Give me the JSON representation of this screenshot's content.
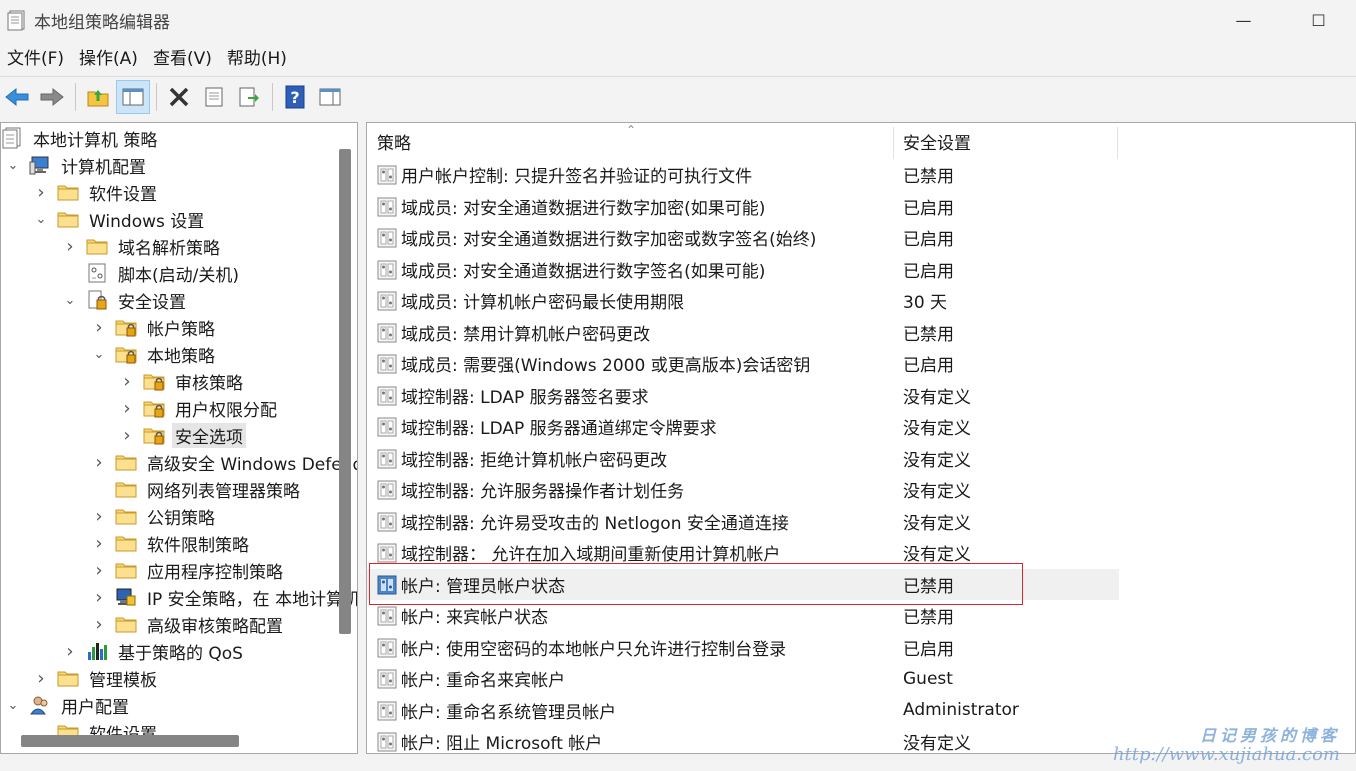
{
  "window": {
    "title": "本地组策略编辑器",
    "minimize": "—",
    "maximize": "☐"
  },
  "menu": [
    "文件(F)",
    "操作(A)",
    "查看(V)",
    "帮助(H)"
  ],
  "tree": [
    {
      "label": "本地计算机 策略",
      "icon": "policy-icon"
    },
    {
      "label": "计算机配置",
      "icon": "computer-icon"
    },
    {
      "label": "软件设置",
      "icon": "folder-icon"
    },
    {
      "label": "Windows 设置",
      "icon": "folder-icon"
    },
    {
      "label": "域名解析策略",
      "icon": "folder-icon"
    },
    {
      "label": "脚本(启动/关机)",
      "icon": "script-icon"
    },
    {
      "label": "安全设置",
      "icon": "security-icon"
    },
    {
      "label": "帐户策略",
      "icon": "lock-folder-icon"
    },
    {
      "label": "本地策略",
      "icon": "lock-folder-icon"
    },
    {
      "label": "审核策略",
      "icon": "lock-folder-icon"
    },
    {
      "label": "用户权限分配",
      "icon": "lock-folder-icon"
    },
    {
      "label": "安全选项",
      "icon": "lock-folder-icon"
    },
    {
      "label": "高级安全 Windows Defender 防火墙",
      "icon": "folder-icon"
    },
    {
      "label": "网络列表管理器策略",
      "icon": "folder-icon"
    },
    {
      "label": "公钥策略",
      "icon": "folder-icon"
    },
    {
      "label": "软件限制策略",
      "icon": "folder-icon"
    },
    {
      "label": "应用程序控制策略",
      "icon": "folder-icon"
    },
    {
      "label": "IP 安全策略，在 本地计算机",
      "icon": "ipsec-icon"
    },
    {
      "label": "高级审核策略配置",
      "icon": "folder-icon"
    },
    {
      "label": "基于策略的 QoS",
      "icon": "chart-icon"
    },
    {
      "label": "管理模板",
      "icon": "folder-icon"
    },
    {
      "label": "用户配置",
      "icon": "user-icon"
    },
    {
      "label": "软件设置",
      "icon": "folder-icon"
    }
  ],
  "columns": {
    "policy": "策略",
    "setting": "安全设置"
  },
  "policies": [
    {
      "name": "用户帐户控制: 只提升签名并验证的可执行文件",
      "value": "已禁用"
    },
    {
      "name": "域成员: 对安全通道数据进行数字加密(如果可能)",
      "value": "已启用"
    },
    {
      "name": "域成员: 对安全通道数据进行数字加密或数字签名(始终)",
      "value": "已启用"
    },
    {
      "name": "域成员: 对安全通道数据进行数字签名(如果可能)",
      "value": "已启用"
    },
    {
      "name": "域成员: 计算机帐户密码最长使用期限",
      "value": "30 天"
    },
    {
      "name": "域成员: 禁用计算机帐户密码更改",
      "value": "已禁用"
    },
    {
      "name": "域成员: 需要强(Windows 2000 或更高版本)会话密钥",
      "value": "已启用"
    },
    {
      "name": "域控制器: LDAP 服务器签名要求",
      "value": "没有定义"
    },
    {
      "name": "域控制器: LDAP 服务器通道绑定令牌要求",
      "value": "没有定义"
    },
    {
      "name": "域控制器: 拒绝计算机帐户密码更改",
      "value": "没有定义"
    },
    {
      "name": "域控制器: 允许服务器操作者计划任务",
      "value": "没有定义"
    },
    {
      "name": "域控制器: 允许易受攻击的 Netlogon 安全通道连接",
      "value": "没有定义"
    },
    {
      "name": "域控制器：  允许在加入域期间重新使用计算机帐户",
      "value": "没有定义"
    },
    {
      "name": "帐户: 管理员帐户状态",
      "value": "已禁用"
    },
    {
      "name": "帐户: 来宾帐户状态",
      "value": "已禁用"
    },
    {
      "name": "帐户: 使用空密码的本地帐户只允许进行控制台登录",
      "value": "已启用"
    },
    {
      "name": "帐户: 重命名来宾帐户",
      "value": "Guest"
    },
    {
      "name": "帐户: 重命名系统管理员帐户",
      "value": "Administrator"
    },
    {
      "name": "帐户: 阻止 Microsoft 帐户",
      "value": "没有定义"
    }
  ],
  "watermark": {
    "line1": "日记男孩的博客",
    "line2": "http://www.xujiahua.com"
  },
  "colors": {
    "highlight_box": "#d9262c",
    "folder": "#f5c542",
    "selection": "#e5e5e5"
  }
}
